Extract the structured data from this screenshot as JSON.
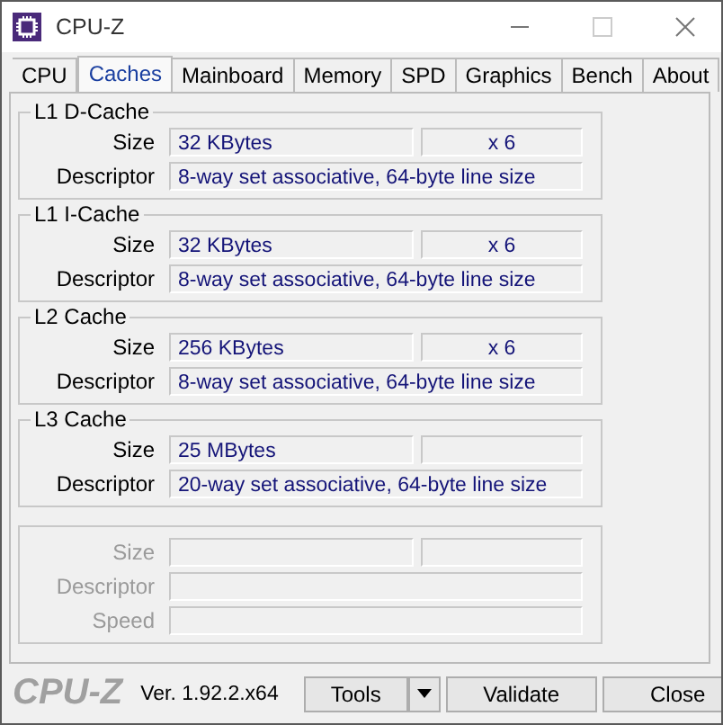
{
  "window": {
    "title": "CPU-Z"
  },
  "tabs": [
    {
      "label": "CPU",
      "selected": false
    },
    {
      "label": "Caches",
      "selected": true
    },
    {
      "label": "Mainboard",
      "selected": false
    },
    {
      "label": "Memory",
      "selected": false
    },
    {
      "label": "SPD",
      "selected": false
    },
    {
      "label": "Graphics",
      "selected": false
    },
    {
      "label": "Bench",
      "selected": false
    },
    {
      "label": "About",
      "selected": false
    }
  ],
  "groups": [
    {
      "title": "L1 D-Cache",
      "disabled": false,
      "rows": [
        {
          "kind": "split",
          "label": "Size",
          "value": "32 KBytes",
          "count": "x 6"
        },
        {
          "kind": "full",
          "label": "Descriptor",
          "value": "8-way set associative, 64-byte line size"
        }
      ]
    },
    {
      "title": "L1 I-Cache",
      "disabled": false,
      "rows": [
        {
          "kind": "split",
          "label": "Size",
          "value": "32 KBytes",
          "count": "x 6"
        },
        {
          "kind": "full",
          "label": "Descriptor",
          "value": "8-way set associative, 64-byte line size"
        }
      ]
    },
    {
      "title": "L2 Cache",
      "disabled": false,
      "rows": [
        {
          "kind": "split",
          "label": "Size",
          "value": "256 KBytes",
          "count": "x 6"
        },
        {
          "kind": "full",
          "label": "Descriptor",
          "value": "8-way set associative, 64-byte line size"
        }
      ]
    },
    {
      "title": "L3 Cache",
      "disabled": false,
      "rows": [
        {
          "kind": "split",
          "label": "Size",
          "value": "25 MBytes"
        },
        {
          "kind": "full",
          "label": "Descriptor",
          "value": "20-way set associative, 64-byte line size"
        }
      ]
    },
    {
      "disabled": true,
      "rows": [
        {
          "kind": "split",
          "label": "Size"
        },
        {
          "kind": "full",
          "label": "Descriptor"
        },
        {
          "kind": "full",
          "label": "Speed"
        }
      ]
    }
  ],
  "footer": {
    "logo": "CPU-Z",
    "version": "Ver. 1.92.2.x64",
    "buttons": [
      "Tools",
      "Validate",
      "Close"
    ]
  }
}
